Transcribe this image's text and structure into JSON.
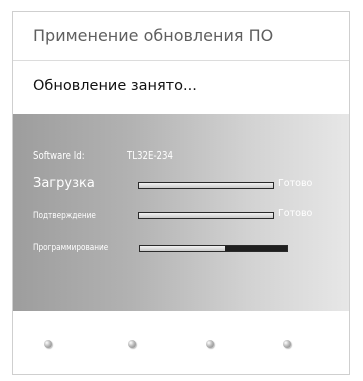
{
  "dialog": {
    "title": "Применение обновления ПО",
    "status": "Обновление занято..."
  },
  "software": {
    "label": "Software Id:",
    "value": "TL32E-234"
  },
  "progress": [
    {
      "label": "Загрузка",
      "value": 1.0,
      "status": "Готово"
    },
    {
      "label": "Подтверждение",
      "value": 1.0,
      "status": "Готово"
    },
    {
      "label": "Программирование",
      "value": 0.58,
      "status": ""
    }
  ],
  "footer": {
    "buttons": [
      {
        "icon": "dot-button-icon"
      },
      {
        "icon": "dot-button-icon"
      },
      {
        "icon": "dot-button-icon"
      },
      {
        "icon": "dot-button-icon"
      }
    ]
  },
  "colors": {
    "panel_bg": "#ffffff",
    "gray_gradient_start": "#9d9d9d",
    "gray_gradient_end": "#e7e7e7",
    "bar_track": "#1f1f1f",
    "bar_fill": "#e8e8e8",
    "text_light": "#ffffff",
    "title_text": "#5f5f5f"
  }
}
